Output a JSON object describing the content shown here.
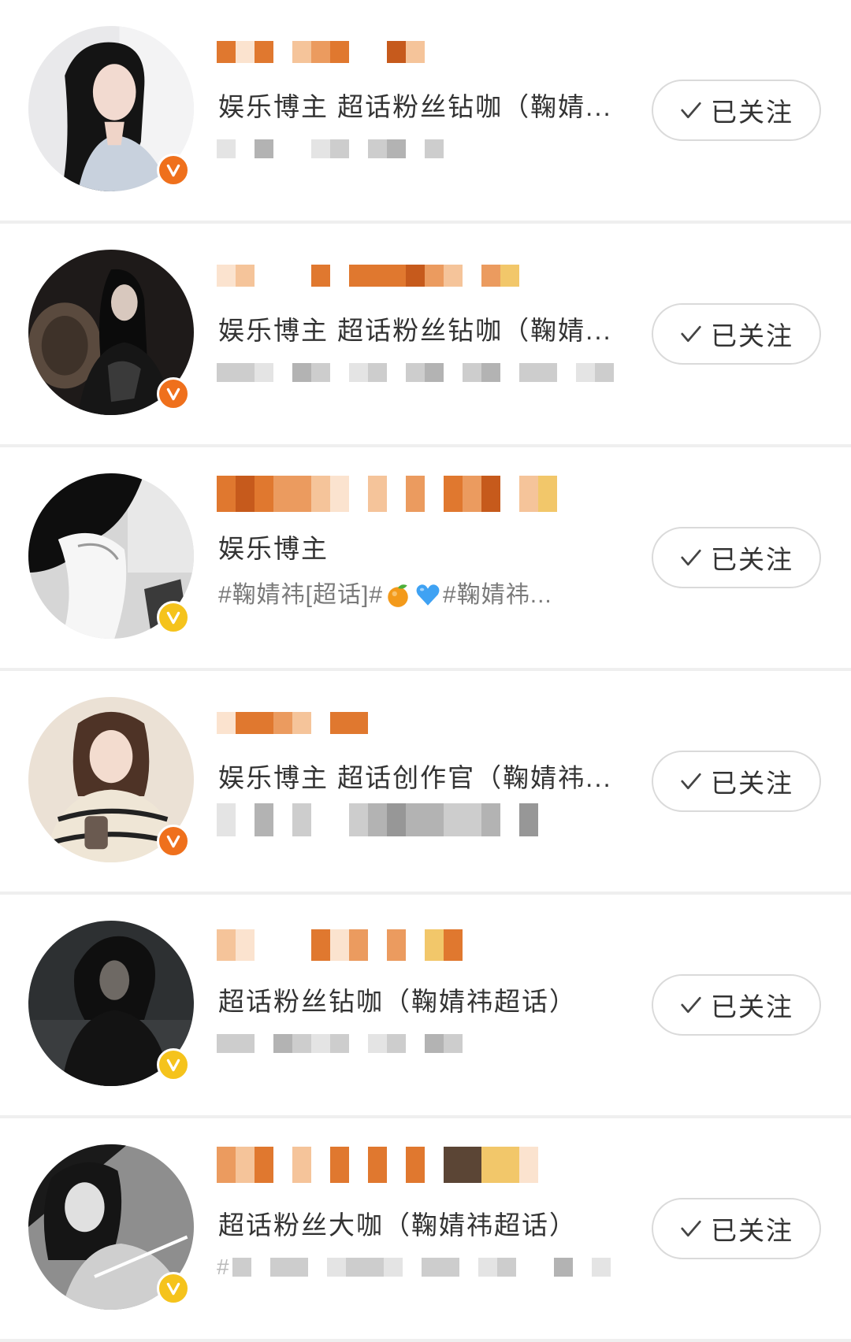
{
  "follow_list": {
    "rows": [
      {
        "description": "娱乐博主 超话粉丝钻咖（鞠婧...",
        "badge": {
          "icon": "verified-badge-icon",
          "color": "#ef701c"
        },
        "follow_button": {
          "icon": "checkmark-icon",
          "label": "已关注"
        }
      },
      {
        "description": "娱乐博主 超话粉丝钻咖（鞠婧...",
        "badge": {
          "icon": "verified-badge-icon",
          "color": "#ef701c"
        },
        "follow_button": {
          "icon": "checkmark-icon",
          "label": "已关注"
        }
      },
      {
        "description": "娱乐博主",
        "tag_line": {
          "prefix": "#鞠婧祎[超话]#",
          "emoji": [
            "tangerine-emoji",
            "blue-heart-emoji"
          ],
          "suffix": "#鞠婧祎..."
        },
        "badge": {
          "icon": "verified-badge-icon",
          "color": "#f5c31c"
        },
        "follow_button": {
          "icon": "checkmark-icon",
          "label": "已关注"
        }
      },
      {
        "description": "娱乐博主 超话创作官（鞠婧祎...",
        "badge": {
          "icon": "verified-badge-icon",
          "color": "#ef701c"
        },
        "follow_button": {
          "icon": "checkmark-icon",
          "label": "已关注"
        }
      },
      {
        "description": "超话粉丝钻咖（鞠婧祎超话）",
        "badge": {
          "icon": "verified-badge-icon",
          "color": "#f5c31c"
        },
        "follow_button": {
          "icon": "checkmark-icon",
          "label": "已关注"
        }
      },
      {
        "description": "超话粉丝大咖（鞠婧祎超话）",
        "info_prefix": "#",
        "badge": {
          "icon": "verified-badge-icon",
          "color": "#f5c31c"
        },
        "follow_button": {
          "icon": "checkmark-icon",
          "label": "已关注"
        }
      }
    ]
  }
}
